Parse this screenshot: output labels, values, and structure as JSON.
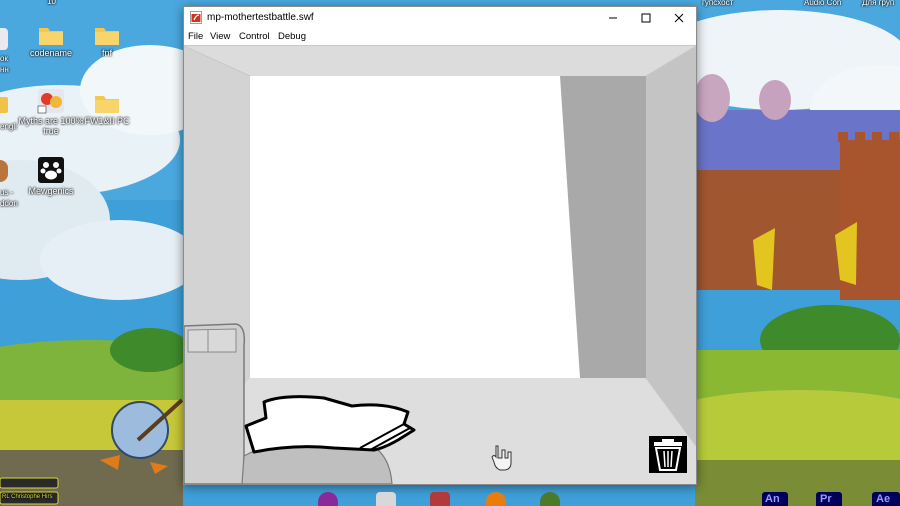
{
  "window": {
    "title": "mp-mothertestbattle.swf",
    "menu": [
      "File",
      "View",
      "Control",
      "Debug"
    ],
    "controls": [
      "minimize-icon",
      "maximize-icon",
      "close-icon"
    ]
  },
  "desktop": {
    "icons": [
      {
        "label": "codename",
        "icon": "folder-icon"
      },
      {
        "label": "fnf",
        "icon": "folder-icon"
      },
      {
        "label": "Myths are 100% true",
        "icon": "app-shortcut-icon"
      },
      {
        "label": "FW1&II PC",
        "icon": "folder-icon"
      },
      {
        "label": "Mewgenics",
        "icon": "paw-shortcut-icon"
      }
    ],
    "partial_labels": {
      "top_left": "10",
      "left_1": "ок",
      "left_2": "нн",
      "left_3": "engli",
      "left_4": "us -",
      "left_5": "ddon",
      "top_right_1": "гупсхост",
      "top_right_2": "Audio Con",
      "top_right_3": "Для груп",
      "widget_bottom": "RL Christophe Hirs"
    }
  },
  "taskbar": {
    "apps": [
      "browser-icon",
      "app-icon",
      "game-icon",
      "blender-icon",
      "app-icon-2"
    ],
    "adobe": [
      "An",
      "Pr",
      "Ae"
    ]
  },
  "stage": {
    "trash_icon": "trash-can-icon",
    "cursor": "hand-pointer-icon"
  },
  "colors": {
    "window_bg": "#ffffff",
    "room_wall_left": "#d7d7d7",
    "room_wall_right": "#a9a9a9",
    "room_floor": "#dedede",
    "screen_white": "#ffffff",
    "an_color": "#9999ff",
    "pr_color": "#9999ff",
    "ae_color": "#9999ff"
  }
}
